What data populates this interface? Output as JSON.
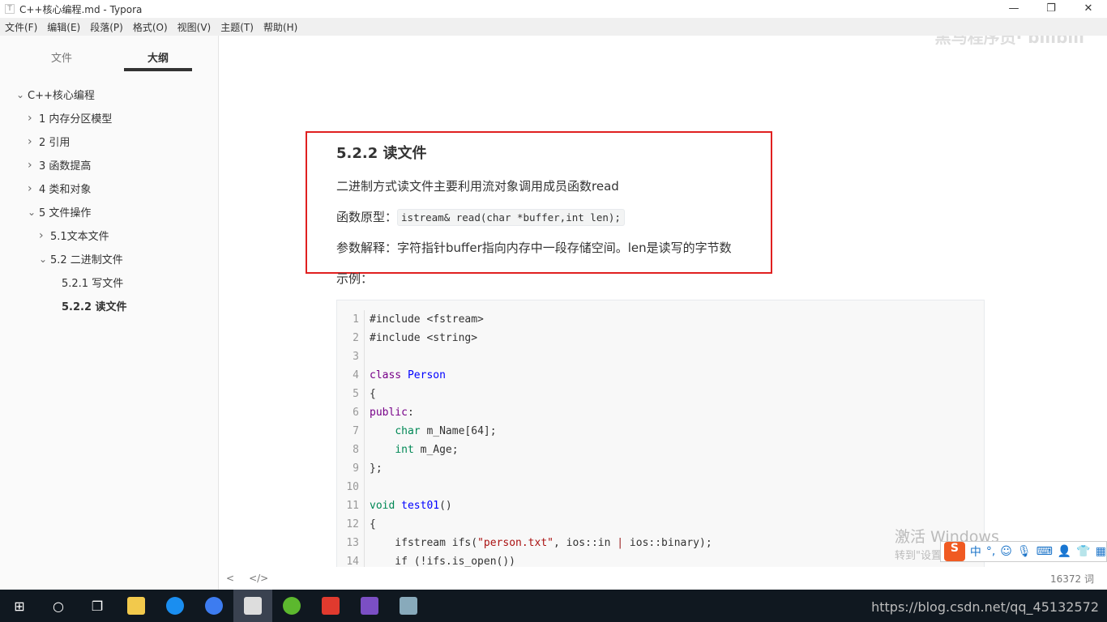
{
  "window": {
    "title": "C++核心编程.md - Typora",
    "app_icon": "T",
    "minimize": "—",
    "restore": "❐",
    "close": "✕"
  },
  "menu": [
    "文件(F)",
    "编辑(E)",
    "段落(P)",
    "格式(O)",
    "视图(V)",
    "主题(T)",
    "帮助(H)"
  ],
  "sidebar": {
    "tabs": [
      {
        "label": "文件",
        "active": false
      },
      {
        "label": "大纲",
        "active": true
      }
    ],
    "outline": [
      {
        "label": "C++核心编程",
        "level": 0,
        "state": "expanded"
      },
      {
        "label": "1 内存分区模型",
        "level": 1,
        "state": "collapsed"
      },
      {
        "label": "2 引用",
        "level": 1,
        "state": "collapsed"
      },
      {
        "label": "3 函数提高",
        "level": 1,
        "state": "collapsed"
      },
      {
        "label": "4 类和对象",
        "level": 1,
        "state": "collapsed"
      },
      {
        "label": "5 文件操作",
        "level": 1,
        "state": "expanded"
      },
      {
        "label": "5.1文本文件",
        "level": 2,
        "state": "collapsed"
      },
      {
        "label": "5.2 二进制文件",
        "level": 2,
        "state": "expanded"
      },
      {
        "label": "5.2.1 写文件",
        "level": 3,
        "state": "leaf"
      },
      {
        "label": "5.2.2 读文件",
        "level": 3,
        "state": "leaf",
        "active": true
      }
    ]
  },
  "editor": {
    "watermark": "黑马程序员· bilibili",
    "heading": "5.2.2 读文件",
    "para1": "二进制方式读文件主要利用流对象调用成员函数read",
    "proto_label": "函数原型：",
    "proto_code": "istream& read(char *buffer,int len);",
    "para3": "参数解释：字符指针buffer指向内存中一段存储空间。len是读写的字节数",
    "example": "示例：",
    "highlight_color": "#e02020",
    "code": [
      [
        [
          "#include <fstream>",
          ""
        ]
      ],
      [
        [
          "#include <string>",
          ""
        ]
      ],
      [],
      [
        [
          "class",
          "kw"
        ],
        [
          " ",
          ""
        ],
        [
          "Person",
          "df"
        ]
      ],
      [
        [
          "{",
          ""
        ]
      ],
      [
        [
          "public",
          "kw"
        ],
        [
          ":",
          ""
        ]
      ],
      [
        [
          "    ",
          ""
        ],
        [
          "char",
          "ty"
        ],
        [
          " m_Name[64];",
          ""
        ]
      ],
      [
        [
          "    ",
          ""
        ],
        [
          "int",
          "ty"
        ],
        [
          " m_Age;",
          ""
        ]
      ],
      [
        [
          "};",
          ""
        ]
      ],
      [],
      [
        [
          "void",
          "ty"
        ],
        [
          " ",
          ""
        ],
        [
          "test01",
          "df"
        ],
        [
          "()",
          ""
        ]
      ],
      [
        [
          "{",
          ""
        ]
      ],
      [
        [
          "    ifstream ifs(",
          ""
        ],
        [
          "\"person.txt\"",
          "str"
        ],
        [
          ", ios::in ",
          ""
        ],
        [
          "|",
          "op"
        ],
        [
          " ios::binary);",
          ""
        ]
      ],
      [
        [
          "    if (!ifs.is_open())",
          ""
        ]
      ]
    ]
  },
  "status": {
    "back": "<",
    "source": "</>",
    "word_count": "16372 词"
  },
  "overlay": {
    "activate_title": "激活 Windows",
    "activate_sub": "转到\"设置\"以激活 Windows。",
    "ime_logo": "S",
    "ime_mode": "中"
  },
  "taskbar": {
    "tray_text": "https://blog.csdn.net/qq_45132572"
  }
}
